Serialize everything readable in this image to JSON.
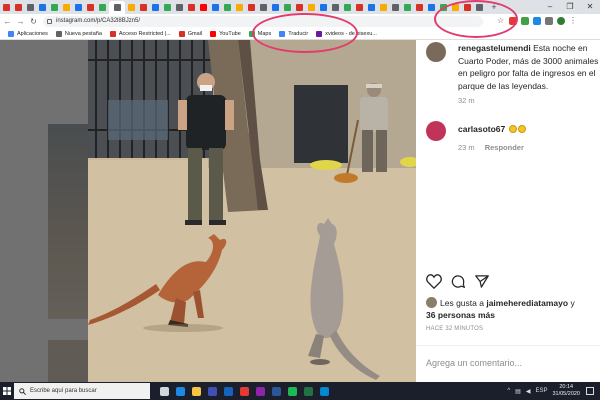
{
  "browser": {
    "tabs": [
      {
        "name": "tab-gmail-1",
        "color": "#d93025"
      },
      {
        "name": "tab-gmail-2",
        "color": "#d93025"
      },
      {
        "name": "tab-page-3",
        "color": "#5f6368"
      },
      {
        "name": "tab-page-4",
        "color": "#1a73e8"
      },
      {
        "name": "tab-page-5",
        "color": "#34a853"
      },
      {
        "name": "tab-page-6",
        "color": "#f9ab00"
      },
      {
        "name": "tab-page-7",
        "color": "#1a73e8"
      },
      {
        "name": "tab-page-8",
        "color": "#d93025"
      },
      {
        "name": "tab-page-9",
        "color": "#34a853"
      },
      {
        "name": "tab-page-10",
        "color": "#5f6368"
      },
      {
        "name": "tab-page-11",
        "color": "#f9ab00"
      },
      {
        "name": "tab-page-12",
        "color": "#d93025"
      },
      {
        "name": "tab-page-13",
        "color": "#1a73e8"
      },
      {
        "name": "tab-page-14",
        "color": "#34a853"
      },
      {
        "name": "tab-page-15",
        "color": "#5f6368"
      },
      {
        "name": "tab-page-16",
        "color": "#d93025"
      },
      {
        "name": "tab-youtube-17",
        "color": "#ff0000"
      },
      {
        "name": "tab-page-18",
        "color": "#1a73e8"
      },
      {
        "name": "tab-page-19",
        "color": "#34a853"
      },
      {
        "name": "tab-page-20",
        "color": "#f9ab00"
      },
      {
        "name": "tab-page-21",
        "color": "#d93025"
      },
      {
        "name": "tab-page-22",
        "color": "#5f6368"
      },
      {
        "name": "tab-page-23",
        "color": "#1a73e8"
      },
      {
        "name": "tab-page-24",
        "color": "#34a853"
      },
      {
        "name": "tab-page-25",
        "color": "#d93025"
      },
      {
        "name": "tab-page-26",
        "color": "#f9ab00"
      },
      {
        "name": "tab-page-27",
        "color": "#1a73e8"
      },
      {
        "name": "tab-page-28",
        "color": "#5f6368"
      },
      {
        "name": "tab-page-29",
        "color": "#34a853"
      },
      {
        "name": "tab-page-30",
        "color": "#d93025"
      },
      {
        "name": "tab-page-31",
        "color": "#1a73e8"
      },
      {
        "name": "tab-page-32",
        "color": "#f9ab00"
      },
      {
        "name": "tab-page-33",
        "color": "#5f6368"
      },
      {
        "name": "tab-page-34",
        "color": "#34a853"
      },
      {
        "name": "tab-page-35",
        "color": "#d93025"
      },
      {
        "name": "tab-page-36",
        "color": "#1a73e8"
      },
      {
        "name": "tab-page-37",
        "color": "#34a853"
      },
      {
        "name": "tab-page-38",
        "color": "#f9ab00"
      },
      {
        "name": "tab-gmail-39",
        "color": "#d93025"
      },
      {
        "name": "tab-page-40",
        "color": "#5f6368"
      }
    ],
    "url": "instagram.com/p/CA32l8BJzn5/",
    "bookmarks": [
      {
        "label": "Aplicaciones",
        "color": "#4285f4"
      },
      {
        "label": "Nueva pestaña",
        "color": "#5f6368"
      },
      {
        "label": "Acceso Restricted |...",
        "color": "#d93025"
      },
      {
        "label": "Gmail",
        "color": "#d93025"
      },
      {
        "label": "YouTube",
        "color": "#ff0000"
      },
      {
        "label": "Maps",
        "color": "#34a853"
      },
      {
        "label": "Traducir",
        "color": "#4285f4"
      },
      {
        "label": "xvideos - de bisexu...",
        "color": "#6a1b9a"
      }
    ]
  },
  "post": {
    "comments": [
      {
        "username": "renegastelumendi",
        "text": "Esta noche en Cuarto Poder, más de 3000 animales en peligro por falta de ingresos en el parque de las leyendas.",
        "time": "32 m",
        "avatar_color": "#7a6a5a"
      },
      {
        "username": "carlasoto67",
        "time": "23 m",
        "reply_label": "Responder",
        "avatar_color": "#c0345a"
      }
    ],
    "likes_prefix": "Les gusta a",
    "likes_user": "jaimeherediatamayo",
    "likes_connector": "y",
    "likes_others": "36 personas más",
    "time_ago": "HACE 32 MINUTOS",
    "add_comment_placeholder": "Agrega un comentario..."
  },
  "taskbar": {
    "search_placeholder": "Escribe aquí para buscar",
    "apps": [
      {
        "name": "task-view",
        "color": "#cfd8dc"
      },
      {
        "name": "edge",
        "color": "#1e88e5"
      },
      {
        "name": "file-explorer",
        "color": "#f6c342"
      },
      {
        "name": "store",
        "color": "#3f51b5"
      },
      {
        "name": "mail",
        "color": "#1565c0"
      },
      {
        "name": "chrome",
        "color": "#e53935"
      },
      {
        "name": "photos",
        "color": "#8e24aa"
      },
      {
        "name": "word",
        "color": "#2b5797"
      },
      {
        "name": "spotify",
        "color": "#1db954"
      },
      {
        "name": "excel",
        "color": "#217346"
      },
      {
        "name": "app-10",
        "color": "#0288d1"
      }
    ],
    "language": "ESP",
    "time": "20:14",
    "date": "31/05/2020"
  }
}
